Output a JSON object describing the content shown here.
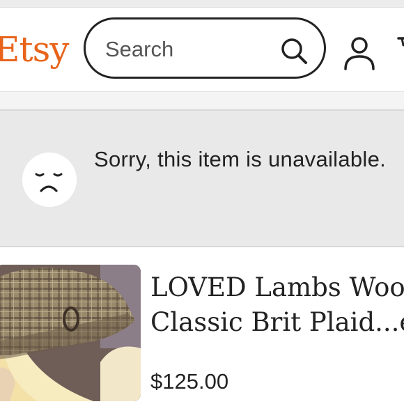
{
  "header": {
    "logo": "Etsy",
    "search_placeholder": "Search"
  },
  "banner": {
    "message": "Sorry, this item is unavailable."
  },
  "listing": {
    "title_line1": "LOVED Lambs Wool",
    "title_line2": "Classic Brit Plaid...en",
    "price": "$125.00"
  },
  "colors": {
    "brand": "#e8641b",
    "banner_bg": "#e9e9e9",
    "text": "#222222"
  },
  "icons": [
    "search-icon",
    "account-icon",
    "sad-face-icon",
    "cart-icon"
  ]
}
